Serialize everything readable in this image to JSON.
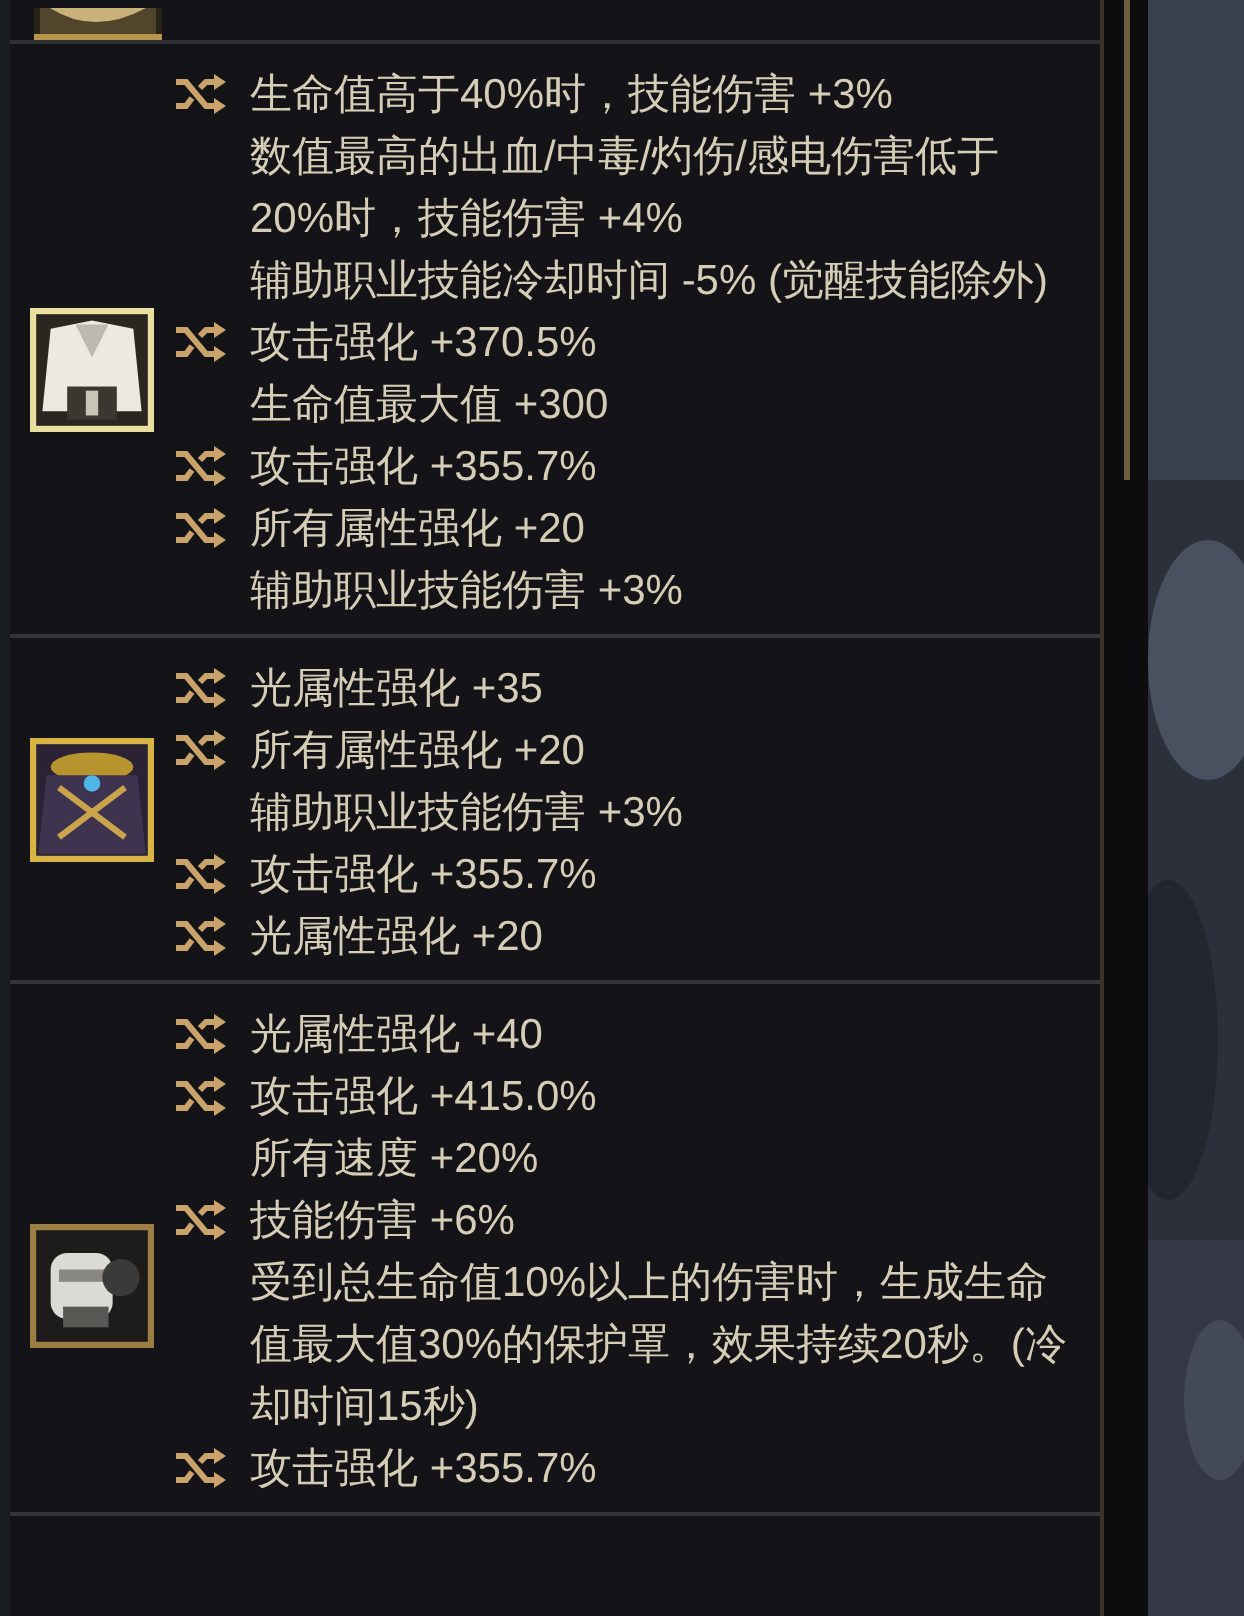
{
  "items": [
    {
      "lines": [
        {
          "text": "生命值高于40%时，技能伤害 +3%",
          "reroll": true
        },
        {
          "text": "数值最高的出血/中毒/灼伤/感电伤害低于20%时，技能伤害 +4%",
          "reroll": false
        },
        {
          "text": "辅助职业技能冷却时间 -5% (觉醒技能除外)",
          "reroll": false
        },
        {
          "text": "攻击强化 +370.5%",
          "reroll": true
        },
        {
          "text": "生命值最大值 +300",
          "reroll": false
        },
        {
          "text": "攻击强化 +355.7%",
          "reroll": true
        },
        {
          "text": "所有属性强化 +20",
          "reroll": true
        },
        {
          "text": "辅助职业技能伤害 +3%",
          "reroll": false
        }
      ]
    },
    {
      "lines": [
        {
          "text": "光属性强化 +35",
          "reroll": true
        },
        {
          "text": "所有属性强化 +20",
          "reroll": true
        },
        {
          "text": "辅助职业技能伤害 +3%",
          "reroll": false
        },
        {
          "text": "攻击强化 +355.7%",
          "reroll": true
        },
        {
          "text": "光属性强化 +20",
          "reroll": true
        }
      ]
    },
    {
      "lines": [
        {
          "text": "光属性强化 +40",
          "reroll": true
        },
        {
          "text": "攻击强化 +415.0%",
          "reroll": true
        },
        {
          "text": "所有速度 +20%",
          "reroll": false
        },
        {
          "text": "技能伤害 +6%",
          "reroll": true
        },
        {
          "text": "受到总生命值10%以上的伤害时，生成生命值最大值30%的保护罩，效果持续20秒。(冷却时间15秒)",
          "reroll": false
        },
        {
          "text": "攻击强化 +355.7%",
          "reroll": true
        }
      ]
    }
  ]
}
